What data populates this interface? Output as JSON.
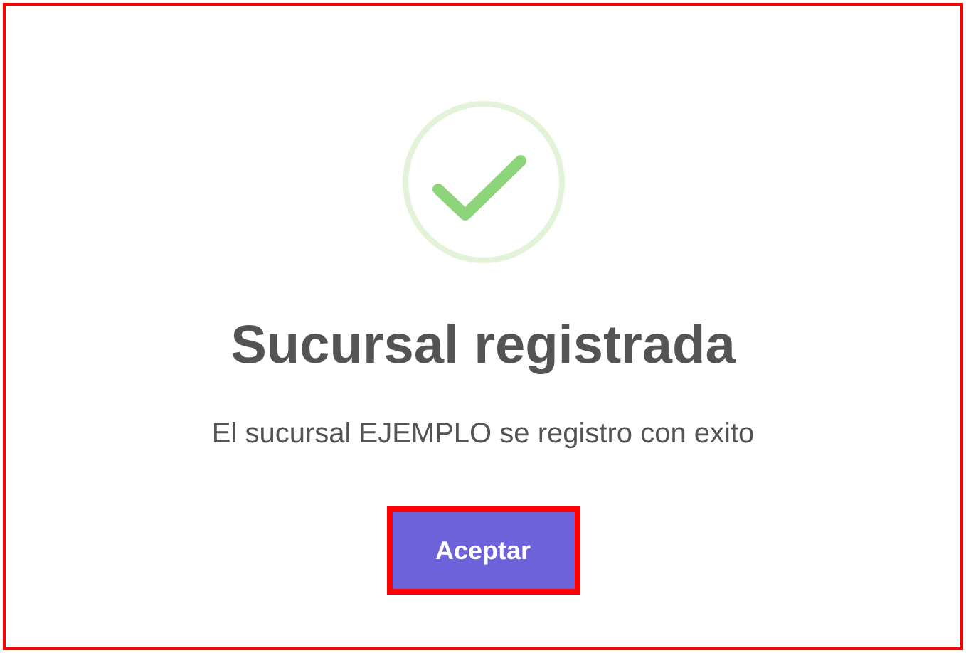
{
  "dialog": {
    "title": "Sucursal registrada",
    "message": "El sucursal EJEMPLO se registro con exito",
    "buttons": [
      "Aceptar"
    ]
  }
}
